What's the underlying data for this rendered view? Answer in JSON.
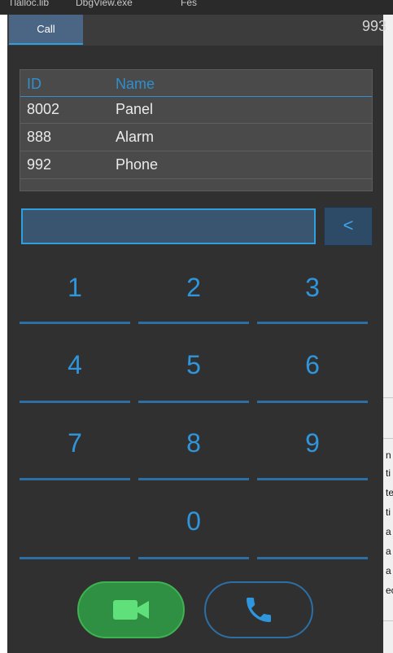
{
  "background": {
    "taskbar_items": [
      "Tlalloc.lib",
      "DbgView.exe",
      "Fes"
    ],
    "side_fragments": [
      "n",
      "ti",
      "te",
      "ti",
      "a",
      "a",
      "a",
      "ec"
    ]
  },
  "window": {
    "tab_call_label": "Call",
    "title_number": "993"
  },
  "contacts": {
    "headers": {
      "id": "ID",
      "name": "Name"
    },
    "rows": [
      {
        "id": "8002",
        "name": "Panel"
      },
      {
        "id": "888",
        "name": "Alarm"
      },
      {
        "id": "992",
        "name": "Phone"
      }
    ]
  },
  "dial": {
    "input_value": "",
    "backspace_label": "<"
  },
  "keypad": {
    "keys": [
      "1",
      "2",
      "3",
      "4",
      "5",
      "6",
      "7",
      "8",
      "9",
      "0"
    ]
  },
  "icons": {
    "video_call": "video-camera-icon",
    "voice_call": "phone-handset-icon"
  },
  "colors": {
    "accent_blue": "#2f95dc",
    "video_green": "#2f8f42",
    "window_bg": "#303030"
  }
}
